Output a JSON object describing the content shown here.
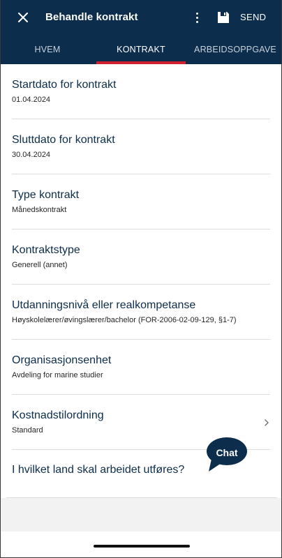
{
  "header": {
    "title": "Behandle kontrakt",
    "send_label": "SEND",
    "icons": {
      "close": "close-icon",
      "more": "more-vertical-icon",
      "save": "save-icon"
    },
    "background": "#0c2d4c"
  },
  "tabs": [
    {
      "label": "HVEM",
      "active": false
    },
    {
      "label": "KONTRAKT",
      "active": true
    },
    {
      "label": "ARBEIDSOPPGAVE",
      "active": false
    }
  ],
  "accent": "#d21f2f",
  "fields": [
    {
      "label": "Startdato for kontrakt",
      "value": "01.04.2024"
    },
    {
      "label": "Sluttdato for kontrakt",
      "value": "30.04.2024"
    },
    {
      "label": "Type kontrakt",
      "value": "Månedskontrakt"
    },
    {
      "label": "Kontraktstype",
      "value": "Generell (annet)"
    },
    {
      "label": "Utdanningsnivå eller realkompetanse",
      "value": "Høyskolelærer/øvingslærer/bachelor (FOR-2006-02-09-129, §1-7)"
    },
    {
      "label": "Organisasjonsenhet",
      "value": "Avdeling for marine studier"
    },
    {
      "label": "Kostnadstilordning",
      "value": "Standard",
      "icon": "chevron-right-icon"
    },
    {
      "label": "I hvilket land skal arbeidet utføres?",
      "value": ""
    }
  ],
  "chat": {
    "label": "Chat",
    "icon": "chat-bubble-icon"
  }
}
